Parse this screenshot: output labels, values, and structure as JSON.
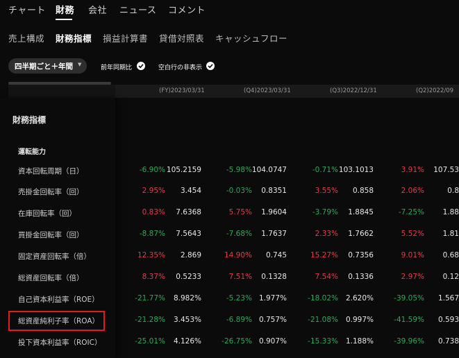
{
  "top_tabs": [
    {
      "label": "チャート",
      "active": false
    },
    {
      "label": "財務",
      "active": true
    },
    {
      "label": "会社",
      "active": false
    },
    {
      "label": "ニュース",
      "active": false
    },
    {
      "label": "コメント",
      "active": false
    }
  ],
  "sub_tabs": [
    {
      "label": "売上構成",
      "active": false
    },
    {
      "label": "財務指標",
      "active": true
    },
    {
      "label": "損益計算書",
      "active": false
    },
    {
      "label": "貸借対照表",
      "active": false
    },
    {
      "label": "キャッシュフロー",
      "active": false
    }
  ],
  "filters": {
    "period_select": "四半期ごと＋年間",
    "yoy_label": "前年同期比",
    "hide_blank_label": "空白行の非表示",
    "yoy_checked": true,
    "hide_blank_checked": true
  },
  "columns": [
    "(FY)2023/03/31",
    "(Q4)2023/03/31",
    "(Q3)2022/12/31",
    "(Q2)2022/09"
  ],
  "section_title": "財務指標",
  "group_title": "運転能力",
  "rows": [
    {
      "label": "資本回転周期（日）",
      "cells": [
        {
          "pct": "-6.90%",
          "dir": "down",
          "val": "105.2159"
        },
        {
          "pct": "-5.98%",
          "dir": "down",
          "val": "104.0747"
        },
        {
          "pct": "-0.71%",
          "dir": "down",
          "val": "103.1013"
        },
        {
          "pct": "3.91%",
          "dir": "up",
          "val": "107.53"
        }
      ]
    },
    {
      "label": "売掛金回転率（回）",
      "cells": [
        {
          "pct": "2.95%",
          "dir": "up",
          "val": "3.454"
        },
        {
          "pct": "-0.03%",
          "dir": "down",
          "val": "0.8351"
        },
        {
          "pct": "3.55%",
          "dir": "up",
          "val": "0.858"
        },
        {
          "pct": "2.06%",
          "dir": "up",
          "val": "0.8"
        }
      ]
    },
    {
      "label": "在庫回転率（回）",
      "cells": [
        {
          "pct": "0.83%",
          "dir": "up",
          "val": "7.6368"
        },
        {
          "pct": "5.75%",
          "dir": "up",
          "val": "1.9604"
        },
        {
          "pct": "-3.79%",
          "dir": "down",
          "val": "1.8845"
        },
        {
          "pct": "-7.25%",
          "dir": "down",
          "val": "1.88"
        }
      ]
    },
    {
      "label": "買掛金回転率（回）",
      "cells": [
        {
          "pct": "-8.87%",
          "dir": "down",
          "val": "7.5643"
        },
        {
          "pct": "-7.68%",
          "dir": "down",
          "val": "1.7637"
        },
        {
          "pct": "2.33%",
          "dir": "up",
          "val": "1.7662"
        },
        {
          "pct": "5.52%",
          "dir": "up",
          "val": "1.81"
        }
      ]
    },
    {
      "label": "固定資産回転率（倍）",
      "cells": [
        {
          "pct": "12.35%",
          "dir": "up",
          "val": "2.869"
        },
        {
          "pct": "14.90%",
          "dir": "up",
          "val": "0.745"
        },
        {
          "pct": "15.27%",
          "dir": "up",
          "val": "0.7356"
        },
        {
          "pct": "9.01%",
          "dir": "up",
          "val": "0.68"
        }
      ]
    },
    {
      "label": "総資産回転率（倍）",
      "cells": [
        {
          "pct": "8.37%",
          "dir": "up",
          "val": "0.5233"
        },
        {
          "pct": "7.51%",
          "dir": "up",
          "val": "0.1328"
        },
        {
          "pct": "7.54%",
          "dir": "up",
          "val": "0.1336"
        },
        {
          "pct": "2.97%",
          "dir": "up",
          "val": "0.12"
        }
      ]
    },
    {
      "label": "自己資本利益率（ROE）",
      "cells": [
        {
          "pct": "-21.77%",
          "dir": "down",
          "val": "8.982%"
        },
        {
          "pct": "-5.23%",
          "dir": "down",
          "val": "1.977%"
        },
        {
          "pct": "-18.02%",
          "dir": "down",
          "val": "2.620%"
        },
        {
          "pct": "-39.05%",
          "dir": "down",
          "val": "1.567"
        }
      ]
    },
    {
      "label": "総資産純利子率（ROA）",
      "cells": [
        {
          "pct": "-21.28%",
          "dir": "down",
          "val": "3.453%"
        },
        {
          "pct": "-6.89%",
          "dir": "down",
          "val": "0.757%"
        },
        {
          "pct": "-21.08%",
          "dir": "down",
          "val": "0.997%"
        },
        {
          "pct": "-41.59%",
          "dir": "down",
          "val": "0.593"
        }
      ]
    },
    {
      "label": "投下資本利益率（ROIC）",
      "cells": [
        {
          "pct": "-25.01%",
          "dir": "down",
          "val": "4.126%"
        },
        {
          "pct": "-26.75%",
          "dir": "down",
          "val": "0.907%"
        },
        {
          "pct": "-15.33%",
          "dir": "down",
          "val": "1.188%"
        },
        {
          "pct": "-39.96%",
          "dir": "down",
          "val": "0.738"
        }
      ]
    }
  ],
  "colors": {
    "up": "#e23b4a",
    "down": "#2fa85a",
    "highlight": "#e01e1e"
  }
}
